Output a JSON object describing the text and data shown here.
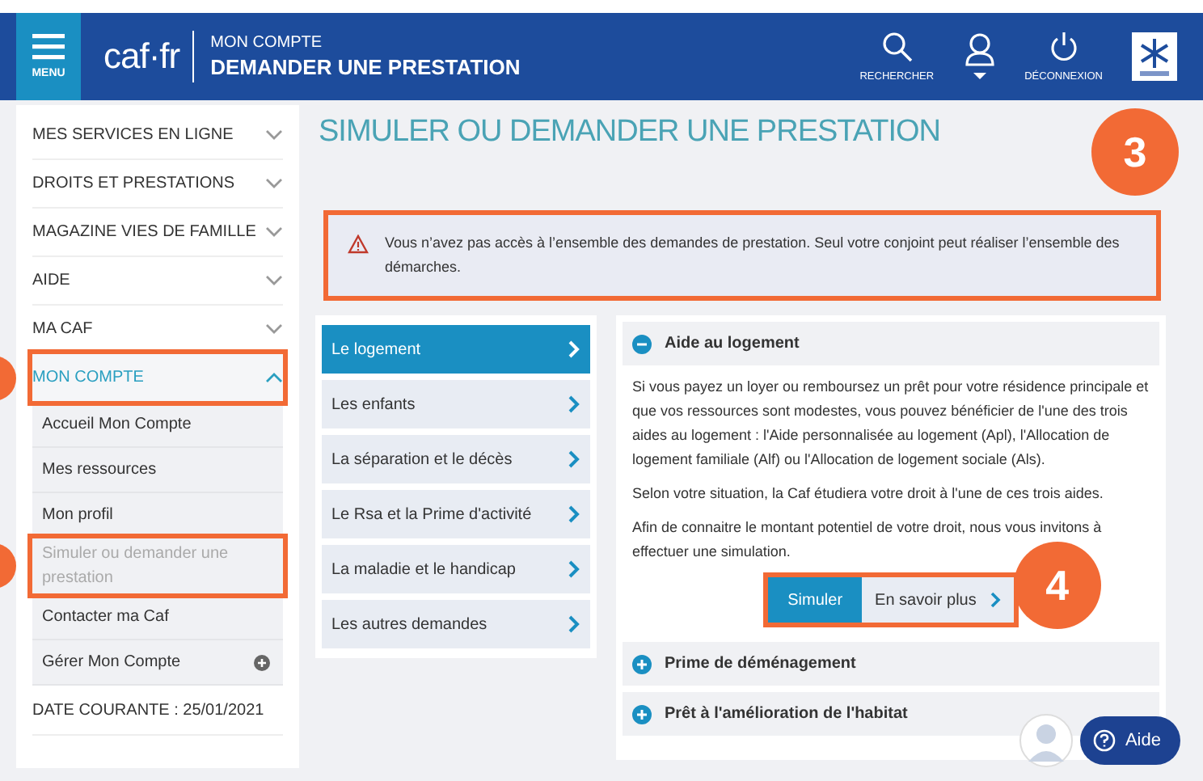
{
  "header": {
    "menu_label": "MENU",
    "logo": "caf·fr",
    "section": "MON COMPTE",
    "title": "DEMANDER UNE PRESTATION",
    "actions": [
      {
        "kind": "search",
        "label": "RECHERCHER"
      },
      {
        "kind": "user"
      },
      {
        "kind": "logout",
        "label": "DÉCONNEXION"
      },
      {
        "kind": "emblem"
      }
    ]
  },
  "sidebar": {
    "items": [
      {
        "label": "MES SERVICES EN LIGNE",
        "expanded": false,
        "highlighted": false
      },
      {
        "label": "DROITS ET PRESTATIONS",
        "expanded": false,
        "highlighted": false
      },
      {
        "label": "MAGAZINE VIES DE FAMILLE",
        "expanded": false,
        "highlighted": false
      },
      {
        "label": "AIDE",
        "expanded": false,
        "highlighted": false
      },
      {
        "label": "MA CAF",
        "expanded": false,
        "highlighted": false
      },
      {
        "label": "MON COMPTE",
        "expanded": true,
        "highlighted": true,
        "children": [
          {
            "label": "Accueil Mon Compte",
            "selected": false,
            "highlighted": false,
            "expandable": false
          },
          {
            "label": "Mes ressources",
            "selected": false,
            "highlighted": false,
            "expandable": false
          },
          {
            "label": "Mon profil",
            "selected": false,
            "highlighted": false,
            "expandable": false
          },
          {
            "label": "Simuler ou demander une prestation",
            "selected": true,
            "highlighted": true,
            "expandable": false
          },
          {
            "label": "Contacter ma Caf",
            "selected": false,
            "highlighted": false,
            "expandable": false
          },
          {
            "label": "Gérer Mon Compte",
            "selected": false,
            "highlighted": false,
            "expandable": true
          }
        ]
      }
    ],
    "date": "DATE COURANTE : 25/01/2021"
  },
  "page_title": "SIMULER OU DEMANDER UNE PRESTATION",
  "alert": {
    "text": "Vous n’avez pas accès à l’ensemble des demandes de prestation. Seul votre conjoint peut réaliser l’ensemble des démarches.",
    "highlighted": true,
    "badge": "3"
  },
  "categories": [
    {
      "label": "Le logement",
      "selected": true
    },
    {
      "label": "Les enfants",
      "selected": false
    },
    {
      "label": "La séparation et le décès",
      "selected": false
    },
    {
      "label": "Le Rsa et la Prime d'activité",
      "selected": false
    },
    {
      "label": "La maladie et le handicap",
      "selected": false
    },
    {
      "label": "Les autres demandes",
      "selected": false
    }
  ],
  "sections": [
    {
      "title": "Aide au logement",
      "expanded": true,
      "paragraphs": [
        "Si vous payez un loyer ou remboursez un prêt pour votre résidence principale et que vos ressources sont modestes, vous pouvez bénéficier de l'une des trois aides au logement : l'Aide personnalisée au logement (Apl), l'Allocation de logement familiale (Alf) ou l'Allocation de logement sociale (Als).",
        "Selon votre situation, la Caf étudiera votre droit à l'une de ces trois aides.",
        "Afin de connaitre le montant potentiel de votre droit, nous vous invitons à effectuer une simulation."
      ],
      "buttons": {
        "primary": "Simuler",
        "secondary": "En savoir plus",
        "highlighted": true,
        "badge": "4"
      }
    },
    {
      "title": "Prime de déménagement",
      "expanded": false
    },
    {
      "title": "Prêt à l'amélioration de l'habitat",
      "expanded": false
    }
  ],
  "help": {
    "label": "Aide"
  }
}
